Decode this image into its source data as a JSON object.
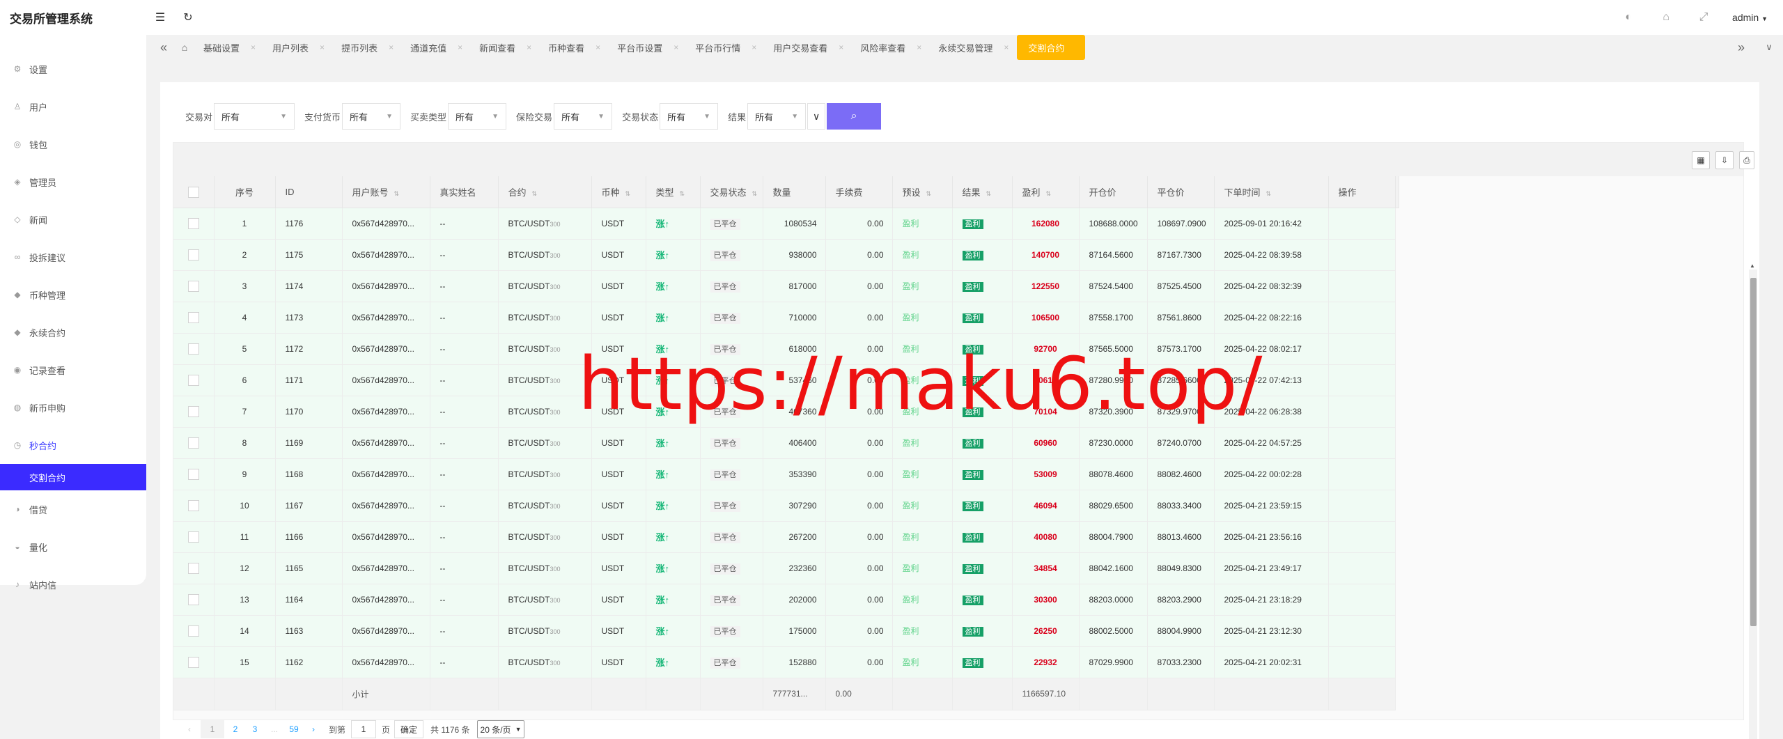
{
  "app": {
    "title": "交易所管理系统",
    "admin": "admin"
  },
  "header_icons": [
    "menu-icon",
    "refresh-icon",
    "palette-icon",
    "tag-icon",
    "fullscreen-icon"
  ],
  "sidebar": {
    "items": [
      {
        "label": "设置",
        "icon": "gear-icon"
      },
      {
        "label": "用户",
        "icon": "user-icon"
      },
      {
        "label": "钱包",
        "icon": "wallet-icon"
      },
      {
        "label": "管理员",
        "icon": "shield-icon"
      },
      {
        "label": "新闻",
        "icon": "tag-icon"
      },
      {
        "label": "投拆建议",
        "icon": "link-icon"
      },
      {
        "label": "币种管理",
        "icon": "diamond-icon"
      },
      {
        "label": "永续合约",
        "icon": "diamond-icon"
      },
      {
        "label": "记录查看",
        "icon": "record-icon"
      },
      {
        "label": "新币申购",
        "icon": "coin-icon"
      },
      {
        "label": "秒合约",
        "icon": "clock-icon"
      }
    ],
    "active_sub": "交割合约",
    "items_after": [
      {
        "label": "借贷",
        "icon": "loan-icon"
      },
      {
        "label": "量化",
        "icon": "chart-icon"
      },
      {
        "label": "站内信",
        "icon": "bell-icon"
      }
    ]
  },
  "tabs": {
    "items": [
      "基础设置",
      "用户列表",
      "提币列表",
      "通道充值",
      "新闻查看",
      "币种查看",
      "平台币设置",
      "平台币行情",
      "用户交易查看",
      "风险率查看",
      "永续交易管理"
    ],
    "active": "交割合约"
  },
  "filter": {
    "fields": [
      {
        "label": "交易对",
        "value": "所有"
      },
      {
        "label": "支付货币",
        "value": "所有"
      },
      {
        "label": "买卖类型",
        "value": "所有"
      },
      {
        "label": "保险交易",
        "value": "所有"
      },
      {
        "label": "交易状态",
        "value": "所有"
      },
      {
        "label": "结果",
        "value": "所有"
      }
    ]
  },
  "table": {
    "headers": [
      "序号",
      "ID",
      "用户账号",
      "真实姓名",
      "合约",
      "币种",
      "类型",
      "交易状态",
      "数量",
      "手续费",
      "预设",
      "结果",
      "盈利",
      "开仓价",
      "平仓价",
      "下单时间",
      "操作"
    ],
    "rows": [
      [
        "1",
        "1176",
        "0x567d428970...",
        "--",
        "BTC/USDT",
        "300",
        "USDT",
        "涨↑",
        "已平仓",
        "1080534",
        "0.00",
        "盈利",
        "盈利",
        "162080",
        "108688.0000",
        "108697.0900",
        "2025-09-01 20:16:42"
      ],
      [
        "2",
        "1175",
        "0x567d428970...",
        "--",
        "BTC/USDT",
        "300",
        "USDT",
        "涨↑",
        "已平仓",
        "938000",
        "0.00",
        "盈利",
        "盈利",
        "140700",
        "87164.5600",
        "87167.7300",
        "2025-04-22 08:39:58"
      ],
      [
        "3",
        "1174",
        "0x567d428970...",
        "--",
        "BTC/USDT",
        "300",
        "USDT",
        "涨↑",
        "已平仓",
        "817000",
        "0.00",
        "盈利",
        "盈利",
        "122550",
        "87524.5400",
        "87525.4500",
        "2025-04-22 08:32:39"
      ],
      [
        "4",
        "1173",
        "0x567d428970...",
        "--",
        "BTC/USDT",
        "300",
        "USDT",
        "涨↑",
        "已平仓",
        "710000",
        "0.00",
        "盈利",
        "盈利",
        "106500",
        "87558.1700",
        "87561.8600",
        "2025-04-22 08:22:16"
      ],
      [
        "5",
        "1172",
        "0x567d428970...",
        "--",
        "BTC/USDT",
        "300",
        "USDT",
        "涨↑",
        "已平仓",
        "618000",
        "0.00",
        "盈利",
        "盈利",
        "92700",
        "87565.5000",
        "87573.1700",
        "2025-04-22 08:02:17"
      ],
      [
        "6",
        "1171",
        "0x567d428970...",
        "--",
        "BTC/USDT",
        "300",
        "USDT",
        "涨↑",
        "已平仓",
        "537460",
        "0.00",
        "盈利",
        "盈利",
        "80619",
        "87280.9900",
        "87285.6600",
        "2025-04-22 07:42:13"
      ],
      [
        "7",
        "1170",
        "0x567d428970...",
        "--",
        "BTC/USDT",
        "300",
        "USDT",
        "涨↑",
        "已平仓",
        "467360",
        "0.00",
        "盈利",
        "盈利",
        "70104",
        "87320.3900",
        "87329.9700",
        "2025-04-22 06:28:38"
      ],
      [
        "8",
        "1169",
        "0x567d428970...",
        "--",
        "BTC/USDT",
        "300",
        "USDT",
        "涨↑",
        "已平仓",
        "406400",
        "0.00",
        "盈利",
        "盈利",
        "60960",
        "87230.0000",
        "87240.0700",
        "2025-04-22 04:57:25"
      ],
      [
        "9",
        "1168",
        "0x567d428970...",
        "--",
        "BTC/USDT",
        "300",
        "USDT",
        "涨↑",
        "已平仓",
        "353390",
        "0.00",
        "盈利",
        "盈利",
        "53009",
        "88078.4600",
        "88082.4600",
        "2025-04-22 00:02:28"
      ],
      [
        "10",
        "1167",
        "0x567d428970...",
        "--",
        "BTC/USDT",
        "300",
        "USDT",
        "涨↑",
        "已平仓",
        "307290",
        "0.00",
        "盈利",
        "盈利",
        "46094",
        "88029.6500",
        "88033.3400",
        "2025-04-21 23:59:15"
      ],
      [
        "11",
        "1166",
        "0x567d428970...",
        "--",
        "BTC/USDT",
        "300",
        "USDT",
        "涨↑",
        "已平仓",
        "267200",
        "0.00",
        "盈利",
        "盈利",
        "40080",
        "88004.7900",
        "88013.4600",
        "2025-04-21 23:56:16"
      ],
      [
        "12",
        "1165",
        "0x567d428970...",
        "--",
        "BTC/USDT",
        "300",
        "USDT",
        "涨↑",
        "已平仓",
        "232360",
        "0.00",
        "盈利",
        "盈利",
        "34854",
        "88042.1600",
        "88049.8300",
        "2025-04-21 23:49:17"
      ],
      [
        "13",
        "1164",
        "0x567d428970...",
        "--",
        "BTC/USDT",
        "300",
        "USDT",
        "涨↑",
        "已平仓",
        "202000",
        "0.00",
        "盈利",
        "盈利",
        "30300",
        "88203.0000",
        "88203.2900",
        "2025-04-21 23:18:29"
      ],
      [
        "14",
        "1163",
        "0x567d428970...",
        "--",
        "BTC/USDT",
        "300",
        "USDT",
        "涨↑",
        "已平仓",
        "175000",
        "0.00",
        "盈利",
        "盈利",
        "26250",
        "88002.5000",
        "88004.9900",
        "2025-04-21 23:12:30"
      ],
      [
        "15",
        "1162",
        "0x567d428970...",
        "--",
        "BTC/USDT",
        "300",
        "USDT",
        "涨↑",
        "已平仓",
        "152880",
        "0.00",
        "盈利",
        "盈利",
        "22932",
        "87029.9900",
        "87033.2300",
        "2025-04-21 20:02:31"
      ]
    ],
    "subtotal": {
      "label": "小计",
      "quantity": "777731...",
      "fee": "0.00",
      "profit": "1166597.10"
    }
  },
  "pagination": {
    "pages": [
      "1",
      "2",
      "3",
      "...",
      "59"
    ],
    "goto_label": "到第",
    "goto_value": "1",
    "page_unit": "页",
    "confirm": "确定",
    "total": "共 1176 条",
    "page_size": "20 条/页"
  },
  "watermark": "https://maku6.top/"
}
